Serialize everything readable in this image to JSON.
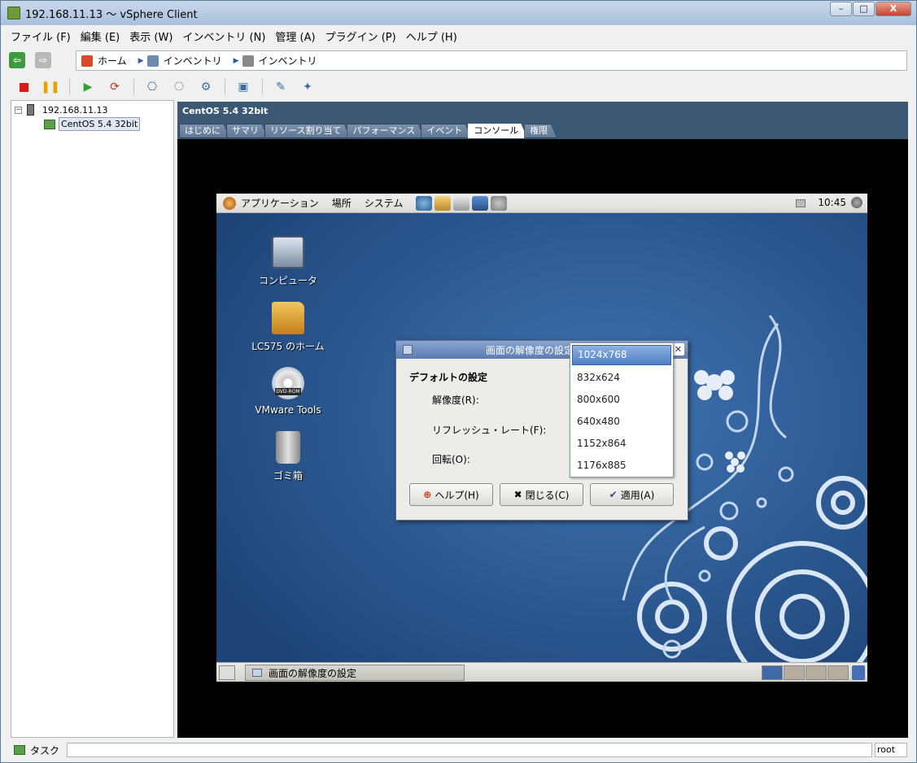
{
  "window": {
    "title": "192.168.11.13 ～ vSphere Client",
    "controls": {
      "minimize": "–",
      "maximize": "□",
      "close": "X"
    }
  },
  "menubar": [
    "ファイル (F)",
    "編集 (E)",
    "表示 (W)",
    "インベントリ (N)",
    "管理 (A)",
    "プラグイン (P)",
    "ヘルプ (H)"
  ],
  "breadcrumb": {
    "home": "ホーム",
    "inventory1": "インベントリ",
    "inventory2": "インベントリ"
  },
  "tree": {
    "host": "192.168.11.13",
    "vm": "CentOS 5.4 32bit"
  },
  "panel": {
    "vm_title": "CentOS 5.4 32bit",
    "tabs": [
      "はじめに",
      "サマリ",
      "リソース割り当て",
      "パフォーマンス",
      "イベント",
      "コンソール",
      "権限"
    ],
    "active_tab": "コンソール"
  },
  "guest": {
    "top_panel": {
      "menus": [
        "アプリケーション",
        "場所",
        "システム"
      ],
      "clock": "10:45"
    },
    "desktop_icons": [
      {
        "label": "コンピュータ"
      },
      {
        "label": "LC575 のホーム"
      },
      {
        "label": "VMware Tools",
        "badge": "DVD-ROM"
      },
      {
        "label": "ゴミ箱"
      }
    ],
    "dialog": {
      "title": "画面の解像度の設定",
      "section": "デフォルトの設定",
      "resolution_label": "解像度(R):",
      "refresh_label": "リフレッシュ・レート(F):",
      "rotation_label": "回転(O):",
      "help_button": "ヘルプ(H)",
      "close_button": "閉じる(C)",
      "apply_button": "適用(A)",
      "close_x": "✕"
    },
    "resolution_options": [
      "1024x768",
      "832x624",
      "800x600",
      "640x480",
      "1152x864",
      "1176x885"
    ],
    "selected_resolution": "1024x768",
    "taskbar_item": "画面の解像度の設定"
  },
  "statusbar": {
    "tasks": "タスク",
    "user": "root"
  }
}
